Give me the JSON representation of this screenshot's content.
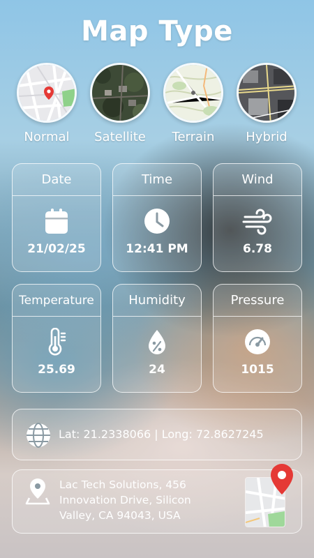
{
  "title": "Map Type",
  "map_types": [
    {
      "label": "Normal",
      "icon": "normal-map-thumbnail"
    },
    {
      "label": "Satellite",
      "icon": "satellite-map-thumbnail"
    },
    {
      "label": "Terrain",
      "icon": "terrain-map-thumbnail"
    },
    {
      "label": "Hybrid",
      "icon": "hybrid-map-thumbnail"
    }
  ],
  "cards": {
    "date": {
      "label": "Date",
      "value": "21/02/25",
      "icon": "calendar-icon"
    },
    "time": {
      "label": "Time",
      "value": "12:41 PM",
      "icon": "clock-icon"
    },
    "wind": {
      "label": "Wind",
      "value": "6.78",
      "icon": "wind-icon"
    },
    "temperature": {
      "label": "Temperature",
      "value": "25.69",
      "icon": "thermometer-icon"
    },
    "humidity": {
      "label": "Humidity",
      "value": "24",
      "icon": "humidity-drop-icon"
    },
    "pressure": {
      "label": "Pressure",
      "value": "1015",
      "icon": "gauge-icon"
    }
  },
  "coordinates": {
    "text": "Lat: 21.2338066 |  Long: 72.8627245",
    "icon": "globe-icon"
  },
  "address": {
    "line1": "Lac Tech Solutions, 456",
    "line2": "Innovation Drive, Silicon",
    "line3": "Valley, CA 94043, USA",
    "icon": "location-pin-icon"
  },
  "colors": {
    "text": "#ffffff",
    "pin_red": "#e53935",
    "card_border": "#ffffff"
  }
}
